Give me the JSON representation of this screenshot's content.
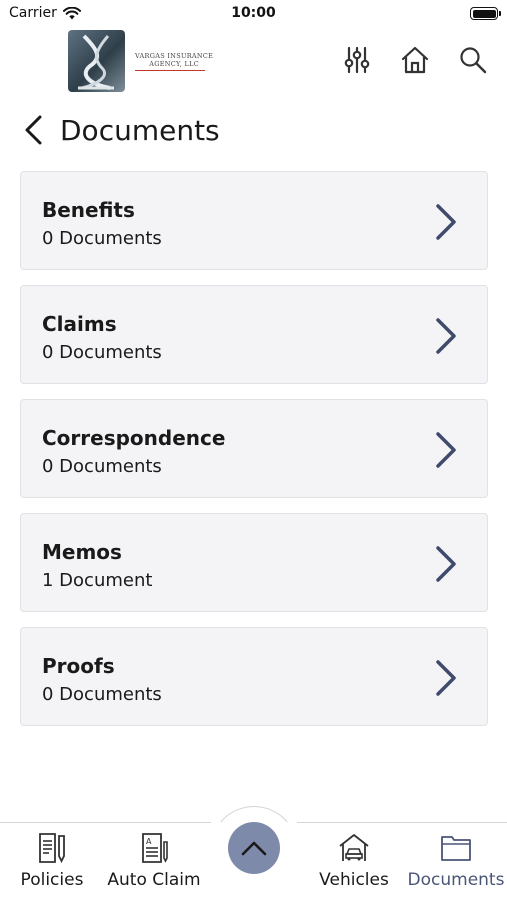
{
  "status_bar": {
    "carrier": "Carrier",
    "time": "10:00"
  },
  "header": {
    "logo_line1": "VARGAS INSURANCE",
    "logo_line2": "AGENCY, LLC",
    "icons": [
      "sliders-icon",
      "home-icon",
      "search-icon"
    ]
  },
  "page": {
    "title": "Documents"
  },
  "documents": [
    {
      "name": "Benefits",
      "count": "0 Documents"
    },
    {
      "name": "Claims",
      "count": "0 Documents"
    },
    {
      "name": "Correspondence",
      "count": "0 Documents"
    },
    {
      "name": "Memos",
      "count": "1 Document"
    },
    {
      "name": "Proofs",
      "count": "0 Documents"
    }
  ],
  "tabs": [
    {
      "label": "Policies",
      "icon": "policy-document-icon"
    },
    {
      "label": "Auto Claim",
      "icon": "claim-form-icon"
    },
    {
      "label": "Vehicles",
      "icon": "garage-car-icon"
    },
    {
      "label": "Documents",
      "icon": "folder-icon",
      "active": true
    }
  ],
  "colors": {
    "accent": "#4a5677",
    "fab": "#7d8aaa",
    "card_bg": "#f4f4f6",
    "chevron": "#3f4b6b"
  }
}
